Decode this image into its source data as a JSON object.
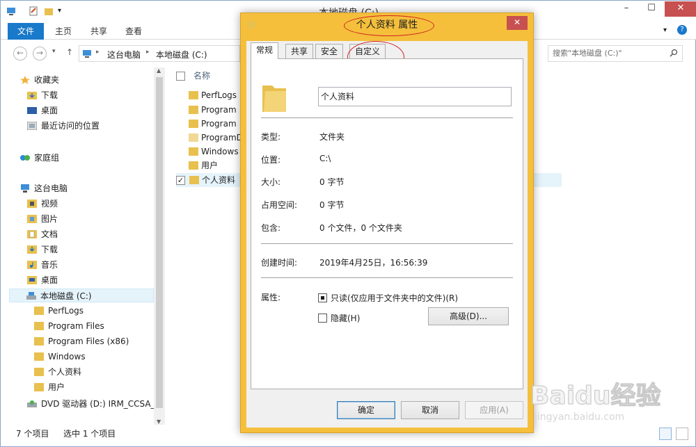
{
  "explorer": {
    "title": "本地磁盘 (C:)",
    "ribbon_tabs": [
      "文件",
      "主页",
      "共享",
      "查看"
    ],
    "breadcrumb": [
      "这台电脑",
      "本地磁盘 (C:)"
    ],
    "search_placeholder": "搜索\"本地磁盘 (C:)\"",
    "column_header": "名称",
    "nav": {
      "favorites": "收藏夹",
      "fav_items": [
        "下载",
        "桌面",
        "最近访问的位置"
      ],
      "homegroup": "家庭组",
      "this_pc": "这台电脑",
      "pc_items": [
        "视频",
        "图片",
        "文档",
        "下载",
        "音乐",
        "桌面"
      ],
      "local_disk": "本地磁盘 (C:)",
      "disk_items": [
        "PerfLogs",
        "Program Files",
        "Program Files (x86)",
        "Windows",
        "个人资料",
        "用户"
      ],
      "dvd": "DVD 驱动器 (D:) IRM_CCSA_X"
    },
    "files": [
      "PerfLogs",
      "Program",
      "Program",
      "ProgramD",
      "Windows",
      "用户",
      "个人资料"
    ],
    "status": {
      "item_count": "7 个项目",
      "selected": "选中 1 个项目"
    }
  },
  "dialog": {
    "title": "个人资料 属性",
    "tabs": [
      "常规",
      "共享",
      "安全",
      "自定义"
    ],
    "name_value": "个人资料",
    "props": {
      "type_label": "类型:",
      "type_value": "文件夹",
      "location_label": "位置:",
      "location_value": "C:\\",
      "size_label": "大小:",
      "size_value": "0 字节",
      "disk_label": "占用空间:",
      "disk_value": "0 字节",
      "contains_label": "包含:",
      "contains_value": "0 个文件，0 个文件夹",
      "created_label": "创建时间:",
      "created_value": "2019年4月25日，16:56:39",
      "attr_label": "属性:",
      "readonly_label": "只读(仅应用于文件夹中的文件)(R)",
      "hidden_label": "隐藏(H)",
      "advanced_button": "高级(D)..."
    },
    "buttons": {
      "ok": "确定",
      "cancel": "取消",
      "apply": "应用(A)"
    }
  },
  "watermark": {
    "main": "Baidu经验",
    "sub": "jingyan.baidu.com"
  },
  "colors": {
    "accent": "#1979ca",
    "dialog_frame": "#f5bf3c",
    "close": "#c75050",
    "annotation": "#d0201e",
    "folder": "#e8c04e"
  }
}
